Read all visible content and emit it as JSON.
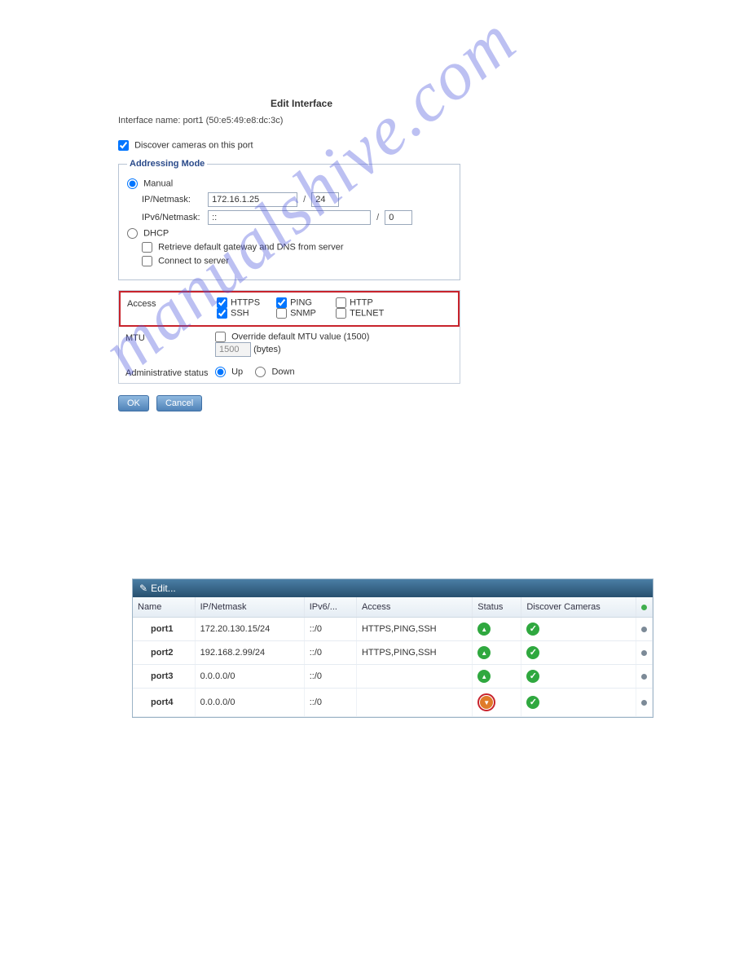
{
  "form": {
    "title": "Edit Interface",
    "interface_line": "Interface name: port1 (50:e5:49:e8:dc:3c)",
    "discover_label": "Discover cameras on this port",
    "legend": "Addressing Mode",
    "manual_label": "Manual",
    "ip_label": "IP/Netmask:",
    "ip_value": "172.16.1.25",
    "ip_mask": "24",
    "ip6_label": "IPv6/Netmask:",
    "ip6_value": "::",
    "ip6_mask": "0",
    "dhcp_label": "DHCP",
    "dhcp_opt1": "Retrieve default gateway and DNS from server",
    "dhcp_opt2": "Connect to server",
    "access_label": "Access",
    "acc": {
      "https": "HTTPS",
      "ping": "PING",
      "http": "HTTP",
      "ssh": "SSH",
      "snmp": "SNMP",
      "telnet": "TELNET"
    },
    "mtu_label": "MTU",
    "mtu_override": "Override default MTU value (1500)",
    "mtu_value": "1500",
    "mtu_unit": "(bytes)",
    "adm_label": "Administrative status",
    "adm_up": "Up",
    "adm_down": "Down",
    "ok": "OK",
    "cancel": "Cancel"
  },
  "watermark": "manualshive.com",
  "table": {
    "edit_label": "Edit...",
    "headers": {
      "name": "Name",
      "ip": "IP/Netmask",
      "ip6": "IPv6/...",
      "access": "Access",
      "status": "Status",
      "discover": "Discover Cameras"
    },
    "rows": [
      {
        "name": "port1",
        "ip": "172.20.130.15/24",
        "ip6": "::/0",
        "access": "HTTPS,PING,SSH",
        "status": "up",
        "discover": "yes"
      },
      {
        "name": "port2",
        "ip": "192.168.2.99/24",
        "ip6": "::/0",
        "access": "HTTPS,PING,SSH",
        "status": "up",
        "discover": "yes"
      },
      {
        "name": "port3",
        "ip": "0.0.0.0/0",
        "ip6": "::/0",
        "access": "",
        "status": "up",
        "discover": "yes"
      },
      {
        "name": "port4",
        "ip": "0.0.0.0/0",
        "ip6": "::/0",
        "access": "",
        "status": "down",
        "discover": "yes"
      }
    ]
  }
}
